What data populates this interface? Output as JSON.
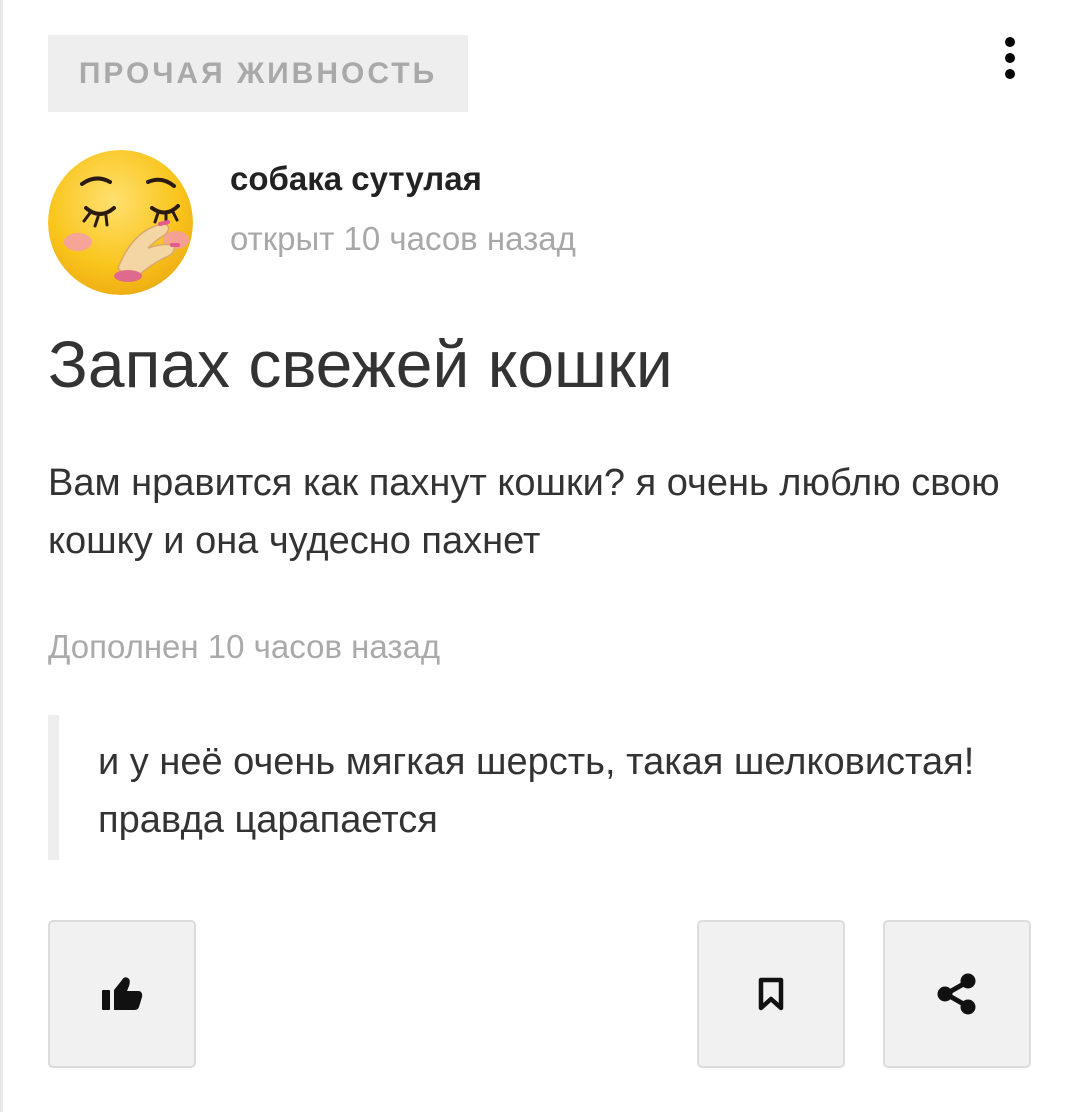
{
  "category": {
    "label": "ПРОЧАЯ ЖИВНОСТЬ"
  },
  "author": {
    "name": "собака сутулая",
    "opened": "открыт 10 часов назад"
  },
  "post": {
    "title": "Запах свежей кошки",
    "body": "Вам нравится как пахнут кошки? я очень люблю свою кошку и она чудесно пахнет"
  },
  "addition": {
    "label": "Дополнен 10 часов назад",
    "text": "и у неё очень мягкая шерсть, такая шелковистая! правда царапается"
  },
  "actions": {
    "like_icon": "thumbs-up-icon",
    "bookmark_icon": "bookmark-icon",
    "share_icon": "share-icon",
    "more_icon": "vertical-dots-icon"
  },
  "colors": {
    "tag_background": "#eeeeee",
    "tag_text": "#a9a9a9",
    "muted_text": "#a8a8a8",
    "main_text": "#333333",
    "button_background": "#f1f1f1",
    "avatar_yellow": "#f9c51c"
  }
}
